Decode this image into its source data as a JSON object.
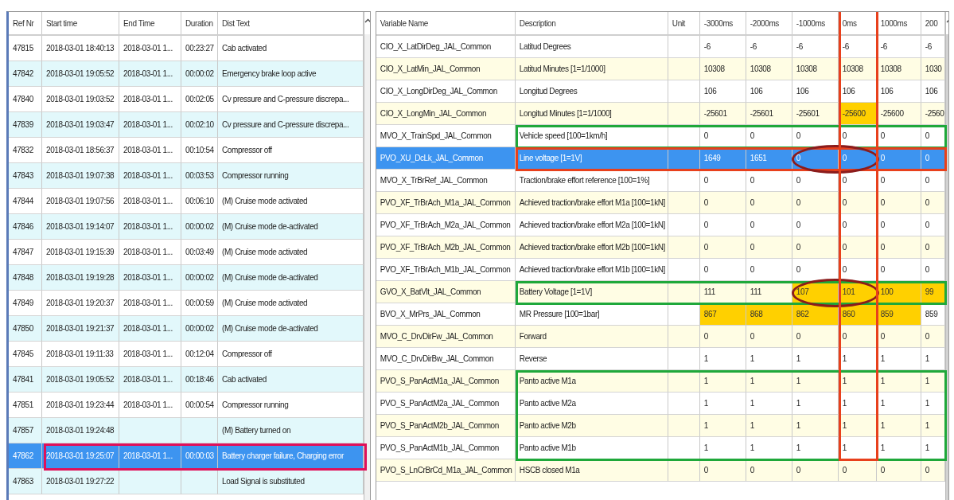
{
  "events_table": {
    "columns": [
      "Ref Nr",
      "Start time",
      "End Time",
      "Duration",
      "Dist Text"
    ],
    "rows": [
      {
        "ref": "47815",
        "start": "2018-03-01 18:40:13",
        "end": "2018-03-01 1...",
        "duration": "00:23:27",
        "text": "Cab activated",
        "selected": false
      },
      {
        "ref": "47842",
        "start": "2018-03-01 19:05:52",
        "end": "2018-03-01 1...",
        "duration": "00:00:02",
        "text": "Emergency brake loop active",
        "selected": false
      },
      {
        "ref": "47840",
        "start": "2018-03-01 19:03:52",
        "end": "2018-03-01 1...",
        "duration": "00:02:05",
        "text": "Cv pressure and C-pressure discrepa...",
        "selected": false
      },
      {
        "ref": "47839",
        "start": "2018-03-01 19:03:47",
        "end": "2018-03-01 1...",
        "duration": "00:02:10",
        "text": "Cv pressure and C-pressure discrepa...",
        "selected": false
      },
      {
        "ref": "47832",
        "start": "2018-03-01 18:56:37",
        "end": "2018-03-01 1...",
        "duration": "00:10:54",
        "text": "Compressor off",
        "selected": false
      },
      {
        "ref": "47843",
        "start": "2018-03-01 19:07:38",
        "end": "2018-03-01 1...",
        "duration": "00:03:53",
        "text": "Compressor running",
        "selected": false
      },
      {
        "ref": "47844",
        "start": "2018-03-01 19:07:56",
        "end": "2018-03-01 1...",
        "duration": "00:06:10",
        "text": "(M) Cruise mode activated",
        "selected": false
      },
      {
        "ref": "47846",
        "start": "2018-03-01 19:14:07",
        "end": "2018-03-01 1...",
        "duration": "00:00:02",
        "text": "(M) Cruise mode de-activated",
        "selected": false
      },
      {
        "ref": "47847",
        "start": "2018-03-01 19:15:39",
        "end": "2018-03-01 1...",
        "duration": "00:03:49",
        "text": "(M) Cruise mode activated",
        "selected": false
      },
      {
        "ref": "47848",
        "start": "2018-03-01 19:19:28",
        "end": "2018-03-01 1...",
        "duration": "00:00:02",
        "text": "(M) Cruise mode de-activated",
        "selected": false
      },
      {
        "ref": "47849",
        "start": "2018-03-01 19:20:37",
        "end": "2018-03-01 1...",
        "duration": "00:00:59",
        "text": "(M) Cruise mode activated",
        "selected": false
      },
      {
        "ref": "47850",
        "start": "2018-03-01 19:21:37",
        "end": "2018-03-01 1...",
        "duration": "00:00:02",
        "text": "(M) Cruise mode de-activated",
        "selected": false
      },
      {
        "ref": "47845",
        "start": "2018-03-01 19:11:33",
        "end": "2018-03-01 1...",
        "duration": "00:12:04",
        "text": "Compressor off",
        "selected": false
      },
      {
        "ref": "47841",
        "start": "2018-03-01 19:05:52",
        "end": "2018-03-01 1...",
        "duration": "00:18:46",
        "text": "Cab activated",
        "selected": false
      },
      {
        "ref": "47851",
        "start": "2018-03-01 19:23:44",
        "end": "2018-03-01 1...",
        "duration": "00:00:54",
        "text": "Compressor running",
        "selected": false
      },
      {
        "ref": "47857",
        "start": "2018-03-01 19:24:48",
        "text": "(M) Battery turned on",
        "selected": false
      },
      {
        "ref": "47862",
        "start": "2018-03-01 19:25:07",
        "end": "2018-03-01 1...",
        "duration": "00:00:03",
        "text": "Battery charger failure, Charging error",
        "selected": true,
        "color": "#e0105a"
      },
      {
        "ref": "47863",
        "start": "2018-03-01 19:27:22",
        "text": "Load Signal is substituted",
        "selected": false
      }
    ]
  },
  "variables_table": {
    "columns": [
      {
        "label": "Variable Name"
      },
      {
        "label": "Description"
      },
      {
        "label": "Unit"
      },
      {
        "label": "-3000ms"
      },
      {
        "label": "-2000ms"
      },
      {
        "label": "-1000ms"
      },
      {
        "label": "0ms",
        "color": "#e8401c"
      },
      {
        "label": "1000ms"
      },
      {
        "label": "200"
      }
    ],
    "rows": [
      {
        "name": "CIO_X_LatDirDeg_JAL_Common",
        "description": "Latitud Degrees",
        "values": [
          "-6",
          "-6",
          "-6",
          "-6",
          "-6",
          "-6"
        ],
        "changed": [
          false,
          false,
          false,
          false,
          false,
          false
        ],
        "selected": false
      },
      {
        "name": "CIO_X_LatMin_JAL_Common",
        "description": "Latitud Minutes [1=1/1000]",
        "values": [
          "10308",
          "10308",
          "10308",
          "10308",
          "10308",
          "1030"
        ],
        "changed": [
          false,
          false,
          false,
          false,
          false,
          false
        ],
        "selected": false
      },
      {
        "name": "CIO_X_LongDirDeg_JAL_Common",
        "description": "Longitud Degrees",
        "values": [
          "106",
          "106",
          "106",
          "106",
          "106",
          "106"
        ],
        "changed": [
          false,
          false,
          false,
          false,
          false,
          false
        ],
        "selected": false
      },
      {
        "name": "CIO_X_LongMin_JAL_Common",
        "description": "Longitud Minutes [1=1/1000]",
        "values": [
          "-25601",
          "-25601",
          "-25601",
          "-25600",
          "-25600",
          "-2560"
        ],
        "changed": [
          false,
          false,
          false,
          true,
          false,
          false
        ],
        "selected": false
      },
      {
        "name": "MVO_X_TrainSpd_JAL_Common",
        "description": "Vehicle speed [100=1km/h]",
        "values": [
          "0",
          "0",
          "0",
          "0",
          "0",
          "0"
        ],
        "changed": [
          false,
          false,
          false,
          false,
          false,
          false
        ],
        "selected": false,
        "color": "#1fa83a"
      },
      {
        "name": "PVO_XU_DcLk_JAL_Common",
        "description": "Line voltage [1=1V]",
        "values": [
          "1649",
          "1651",
          "0",
          "0",
          "0",
          "0"
        ],
        "changed": [
          false,
          false,
          false,
          false,
          false,
          false
        ],
        "circled": [
          false,
          false,
          true,
          true,
          false,
          false
        ],
        "selected": true,
        "color": "#e8401c"
      },
      {
        "name": "MVO_X_TrBrRef_JAL_Common",
        "description": "Traction/brake effort reference [100=1%]",
        "values": [
          "0",
          "0",
          "0",
          "0",
          "0",
          "0"
        ],
        "changed": [
          false,
          false,
          false,
          false,
          false,
          false
        ],
        "selected": false
      },
      {
        "name": "PVO_XF_TrBrAch_M1a_JAL_Common",
        "description": "Achieved traction/brake effort M1a [100=1kN]",
        "values": [
          "0",
          "0",
          "0",
          "0",
          "0",
          "0"
        ],
        "changed": [
          false,
          false,
          false,
          false,
          false,
          false
        ],
        "selected": false
      },
      {
        "name": "PVO_XF_TrBrAch_M2a_JAL_Common",
        "description": "Achieved traction/brake effort M2a [100=1kN]",
        "values": [
          "0",
          "0",
          "0",
          "0",
          "0",
          "0"
        ],
        "changed": [
          false,
          false,
          false,
          false,
          false,
          false
        ],
        "selected": false
      },
      {
        "name": "PVO_XF_TrBrAch_M2b_JAL_Common",
        "description": "Achieved traction/brake effort M2b [100=1kN]",
        "values": [
          "0",
          "0",
          "0",
          "0",
          "0",
          "0"
        ],
        "changed": [
          false,
          false,
          false,
          false,
          false,
          false
        ],
        "selected": false
      },
      {
        "name": "PVO_XF_TrBrAch_M1b_JAL_Common",
        "description": "Achieved traction/brake effort M1b [100=1kN]",
        "values": [
          "0",
          "0",
          "0",
          "0",
          "0",
          "0"
        ],
        "changed": [
          false,
          false,
          false,
          false,
          false,
          false
        ],
        "selected": false
      },
      {
        "name": "GVO_X_BatVlt_JAL_Common",
        "description": "Battery Voltage [1=1V]",
        "values": [
          "111",
          "111",
          "107",
          "101",
          "100",
          "99"
        ],
        "changed": [
          false,
          false,
          true,
          true,
          true,
          true
        ],
        "circled": [
          false,
          false,
          true,
          true,
          false,
          false
        ],
        "selected": false,
        "color": "#1fa83a"
      },
      {
        "name": "BVO_X_MrPrs_JAL_Common",
        "description": "MR Pressure [100=1bar]",
        "values": [
          "867",
          "868",
          "862",
          "860",
          "859",
          "859"
        ],
        "changed": [
          true,
          true,
          true,
          true,
          true,
          false
        ],
        "selected": false
      },
      {
        "name": "MVO_C_DrvDirFw_JAL_Common",
        "description": "Forward",
        "values": [
          "0",
          "0",
          "0",
          "0",
          "0",
          "0"
        ],
        "changed": [
          false,
          false,
          false,
          false,
          false,
          false
        ],
        "selected": false
      },
      {
        "name": "MVO_C_DrvDirBw_JAL_Common",
        "description": "Reverse",
        "values": [
          "1",
          "1",
          "1",
          "1",
          "1",
          "1"
        ],
        "changed": [
          false,
          false,
          false,
          false,
          false,
          false
        ],
        "selected": false
      },
      {
        "name": "PVO_S_PanActM1a_JAL_Common",
        "description": "Panto active M1a",
        "values": [
          "1",
          "1",
          "1",
          "1",
          "1",
          "1"
        ],
        "changed": [
          false,
          false,
          false,
          false,
          false,
          false
        ],
        "selected": false,
        "color": "#1fa83a"
      },
      {
        "name": "PVO_S_PanActM2a_JAL_Common",
        "description": "Panto active M2a",
        "values": [
          "1",
          "1",
          "1",
          "1",
          "1",
          "1"
        ],
        "changed": [
          false,
          false,
          false,
          false,
          false,
          false
        ],
        "selected": false,
        "color": "#1fa83a"
      },
      {
        "name": "PVO_S_PanActM2b_JAL_Common",
        "description": "Panto active M2b",
        "values": [
          "1",
          "1",
          "1",
          "1",
          "1",
          "1"
        ],
        "changed": [
          false,
          false,
          false,
          false,
          false,
          false
        ],
        "selected": false,
        "color": "#1fa83a"
      },
      {
        "name": "PVO_S_PanActM1b_JAL_Common",
        "description": "Panto active M1b",
        "values": [
          "1",
          "1",
          "1",
          "1",
          "1",
          "1"
        ],
        "changed": [
          false,
          false,
          false,
          false,
          false,
          false
        ],
        "selected": false,
        "color": "#1fa83a"
      },
      {
        "name": "PVO_S_LnCrBrCd_M1a_JAL_Common",
        "description": "HSCB closed M1a",
        "values": [
          "0",
          "0",
          "0",
          "0",
          "0",
          "0"
        ],
        "changed": [
          false,
          false,
          false,
          false,
          false,
          false
        ],
        "selected": false
      }
    ]
  }
}
